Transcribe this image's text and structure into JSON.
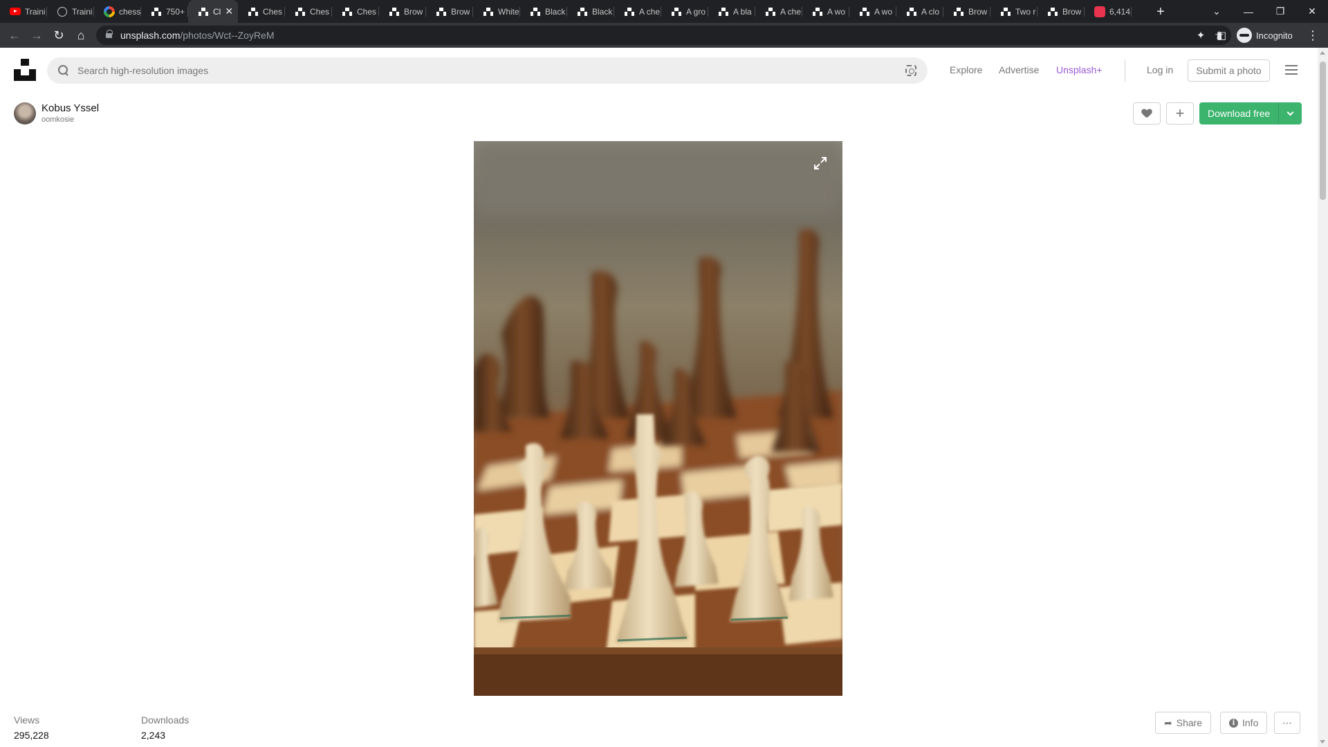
{
  "browser": {
    "tabs": [
      {
        "title": "Traini",
        "icon": "youtube-icon"
      },
      {
        "title": "Traini",
        "icon": "globe-icon"
      },
      {
        "title": "chess",
        "icon": "google-icon"
      },
      {
        "title": "750+",
        "icon": "unsplash-icon"
      },
      {
        "title": "Cl",
        "icon": "unsplash-icon",
        "active": true
      },
      {
        "title": "Ches",
        "icon": "unsplash-icon"
      },
      {
        "title": "Ches",
        "icon": "unsplash-icon"
      },
      {
        "title": "Ches",
        "icon": "unsplash-icon"
      },
      {
        "title": "Brow",
        "icon": "unsplash-icon"
      },
      {
        "title": "Brow",
        "icon": "unsplash-icon"
      },
      {
        "title": "White",
        "icon": "unsplash-icon"
      },
      {
        "title": "Black",
        "icon": "unsplash-icon"
      },
      {
        "title": "Black",
        "icon": "unsplash-icon"
      },
      {
        "title": "A che",
        "icon": "unsplash-icon"
      },
      {
        "title": "A gro",
        "icon": "unsplash-icon"
      },
      {
        "title": "A bla",
        "icon": "unsplash-icon"
      },
      {
        "title": "A che",
        "icon": "unsplash-icon"
      },
      {
        "title": "A wo",
        "icon": "unsplash-icon"
      },
      {
        "title": "A wo",
        "icon": "unsplash-icon"
      },
      {
        "title": "A clo",
        "icon": "unsplash-icon"
      },
      {
        "title": "Brow",
        "icon": "unsplash-icon"
      },
      {
        "title": "Two r",
        "icon": "unsplash-icon"
      },
      {
        "title": "Brow",
        "icon": "unsplash-icon"
      },
      {
        "title": "6,414",
        "icon": "red-app-icon"
      }
    ],
    "url_host": "unsplash.com",
    "url_path": "/photos/Wct--ZoyReM",
    "profile_label": "Incognito"
  },
  "header": {
    "search_placeholder": "Search high-resolution images",
    "nav": {
      "explore": "Explore",
      "advertise": "Advertise",
      "unsplash_plus": "Unsplash+",
      "login": "Log in",
      "submit": "Submit a photo"
    }
  },
  "photo_page": {
    "author_name": "Kobus Yssel",
    "author_handle": "oomkosie",
    "download_label": "Download free",
    "stats": [
      {
        "label": "Views",
        "value": "295,228"
      },
      {
        "label": "Downloads",
        "value": "2,243"
      }
    ],
    "actions": {
      "share": "Share",
      "info": "Info",
      "more": "⋯"
    }
  },
  "colors": {
    "accent_green": "#3cb46e",
    "unsplash_plus": "#9a5bd6"
  }
}
